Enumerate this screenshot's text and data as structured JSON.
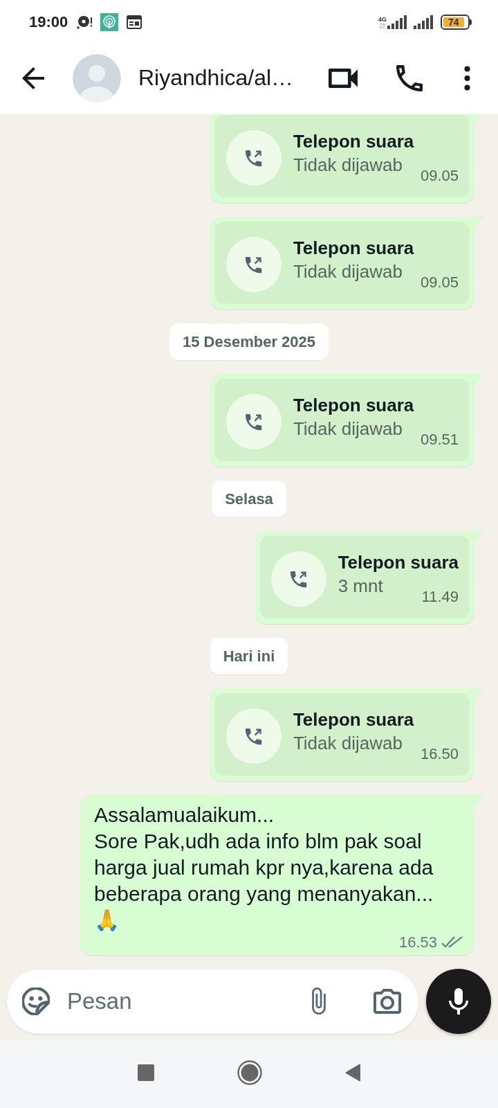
{
  "status_bar": {
    "time": "19:00",
    "network": "4G",
    "battery": "74"
  },
  "header": {
    "contact_name": "Riyandhica/al…"
  },
  "messages": [
    {
      "kind": "call",
      "outgoing": true,
      "title": "Telepon suara",
      "detail": "Tidak dijawab",
      "time": "09.05"
    },
    {
      "kind": "call",
      "outgoing": true,
      "title": "Telepon suara",
      "detail": "Tidak dijawab",
      "time": "09.05"
    },
    {
      "kind": "date",
      "label": "15 Desember 2025"
    },
    {
      "kind": "call",
      "outgoing": true,
      "title": "Telepon suara",
      "detail": "Tidak dijawab",
      "time": "09.51"
    },
    {
      "kind": "date",
      "label": "Selasa"
    },
    {
      "kind": "call",
      "outgoing": true,
      "title": "Telepon suara",
      "detail": "3 mnt",
      "time": "11.49"
    },
    {
      "kind": "date",
      "label": "Hari ini"
    },
    {
      "kind": "call",
      "outgoing": true,
      "title": "Telepon suara",
      "detail": "Tidak dijawab",
      "time": "16.50"
    },
    {
      "kind": "text",
      "text": "Assalamualaikum...\nSore Pak,udh ada info blm pak soal harga jual rumah kpr nya,karena ada beberapa orang yang menanyakan...\n🙏",
      "time": "16.53",
      "read": false
    }
  ],
  "composer": {
    "placeholder": "Pesan"
  }
}
